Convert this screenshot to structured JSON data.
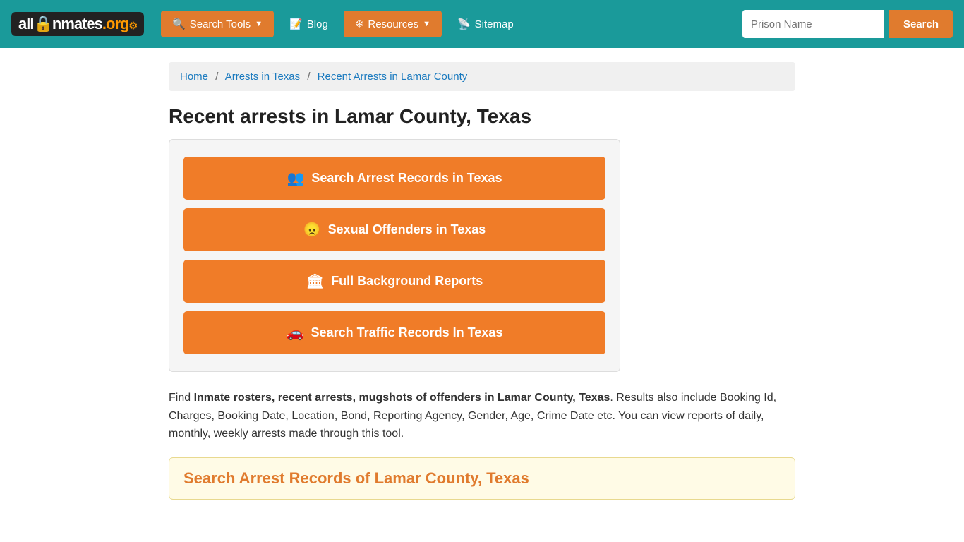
{
  "site": {
    "logo_all": "all",
    "logo_inmates": "Inmates",
    "logo_org": ".org"
  },
  "navbar": {
    "search_tools_label": "Search Tools",
    "blog_label": "Blog",
    "resources_label": "Resources",
    "sitemap_label": "Sitemap",
    "search_placeholder": "Prison Name",
    "search_btn_label": "Search"
  },
  "breadcrumb": {
    "home": "Home",
    "arrests_in_texas": "Arrests in Texas",
    "current": "Recent Arrests in Lamar County"
  },
  "page": {
    "title": "Recent arrests in Lamar County, Texas",
    "description_intro": "Find ",
    "description_bold": "Inmate rosters, recent arrests, mugshots of offenders in Lamar County, Texas",
    "description_rest": ". Results also include Booking Id, Charges, Booking Date, Location, Bond, Reporting Agency, Gender, Age, Crime Date etc. You can view reports of daily, monthly, weekly arrests made through this tool.",
    "search_section_title": "Search Arrest Records of Lamar County, Texas"
  },
  "action_buttons": [
    {
      "label": "Search Arrest Records in Texas",
      "icon": "👥"
    },
    {
      "label": "Sexual Offenders in Texas",
      "icon": "😠"
    },
    {
      "label": "Full Background Reports",
      "icon": "🏛"
    },
    {
      "label": "Search Traffic Records In Texas",
      "icon": "🚗"
    }
  ]
}
